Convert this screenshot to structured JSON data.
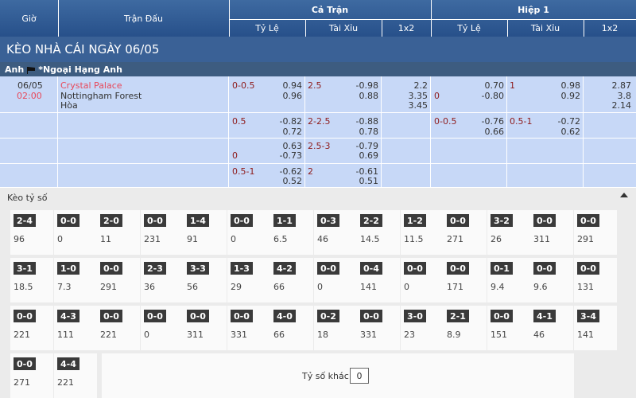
{
  "header": {
    "time": "Giờ",
    "match": "Trận Đấu",
    "full_match": "Cả Trận",
    "first_half": "Hiệp 1",
    "handicap": "Tỷ Lệ",
    "over_under": "Tài Xỉu",
    "one_x_two": "1x2"
  },
  "date_title": "KÈO NHÀ CÁI NGÀY 06/05",
  "league": {
    "country": "Anh",
    "name": "*Ngoại Hạng Anh"
  },
  "match": {
    "date": "06/05",
    "time": "02:00",
    "home": "Crystal Palace",
    "away": "Nottingham Forest",
    "draw": "Hòa"
  },
  "odds_rows": [
    {
      "ft_hdp": {
        "line": "0-0.5",
        "line2": "",
        "home": "0.94",
        "away": "0.96"
      },
      "ft_ou": {
        "line": "2.5",
        "over": "-0.98",
        "under": "0.88"
      },
      "ft_1x2": [
        "2.2",
        "3.35",
        "3.45"
      ],
      "h1_hdp": {
        "line": "",
        "line2": "0",
        "home": "0.70",
        "away": "-0.80"
      },
      "h1_ou": {
        "line": "1",
        "over": "0.98",
        "under": "0.92"
      },
      "h1_1x2": [
        "2.87",
        "3.8",
        "2.14"
      ]
    },
    {
      "ft_hdp": {
        "line": "0.5",
        "line2": "",
        "home": "-0.82",
        "away": "0.72"
      },
      "ft_ou": {
        "line": "2-2.5",
        "over": "-0.88",
        "under": "0.78"
      },
      "h1_hdp": {
        "line": "0-0.5",
        "line2": "",
        "home": "-0.76",
        "away": "0.66"
      },
      "h1_ou": {
        "line": "0.5-1",
        "over": "-0.72",
        "under": "0.62"
      }
    },
    {
      "ft_hdp": {
        "line": "",
        "line2": "0",
        "home": "0.63",
        "away": "-0.73"
      },
      "ft_ou": {
        "line": "2.5-3",
        "over": "-0.79",
        "under": "0.69"
      }
    },
    {
      "ft_hdp": {
        "line": "0.5-1",
        "line2": "",
        "home": "-0.62",
        "away": "0.52"
      },
      "ft_ou": {
        "line": "2",
        "over": "-0.61",
        "under": "0.51"
      }
    }
  ],
  "score_section": {
    "title": "Kèo tỷ số",
    "other_label": "Tỷ số khác",
    "other_value": "0",
    "scores": [
      [
        "2-4",
        "96"
      ],
      [
        "0-0",
        "0"
      ],
      [
        "2-0",
        "11"
      ],
      [
        "0-0",
        "231"
      ],
      [
        "1-4",
        "91"
      ],
      [
        "0-0",
        "0"
      ],
      [
        "1-1",
        "6.5"
      ],
      [
        "0-3",
        "46"
      ],
      [
        "2-2",
        "14.5"
      ],
      [
        "1-2",
        "11.5"
      ],
      [
        "0-0",
        "271"
      ],
      [
        "3-2",
        "26"
      ],
      [
        "0-0",
        "311"
      ],
      [
        "0-0",
        "291"
      ],
      [
        "3-1",
        "18.5"
      ],
      [
        "1-0",
        "7.3"
      ],
      [
        "0-0",
        "291"
      ],
      [
        "2-3",
        "36"
      ],
      [
        "3-3",
        "56"
      ],
      [
        "1-3",
        "29"
      ],
      [
        "4-2",
        "66"
      ],
      [
        "0-0",
        "0"
      ],
      [
        "0-4",
        "141"
      ],
      [
        "0-0",
        "0"
      ],
      [
        "0-0",
        "171"
      ],
      [
        "0-1",
        "9.4"
      ],
      [
        "0-0",
        "9.6"
      ],
      [
        "0-0",
        "131"
      ],
      [
        "0-0",
        "221"
      ],
      [
        "4-3",
        "111"
      ],
      [
        "0-0",
        "221"
      ],
      [
        "0-0",
        "0"
      ],
      [
        "0-0",
        "311"
      ],
      [
        "0-0",
        "331"
      ],
      [
        "4-0",
        "66"
      ],
      [
        "0-2",
        "18"
      ],
      [
        "0-0",
        "331"
      ],
      [
        "3-0",
        "23"
      ],
      [
        "2-1",
        "8.9"
      ],
      [
        "0-0",
        "151"
      ],
      [
        "4-1",
        "46"
      ],
      [
        "3-4",
        "141"
      ],
      [
        "0-0",
        "271"
      ],
      [
        "4-4",
        "221"
      ]
    ]
  }
}
